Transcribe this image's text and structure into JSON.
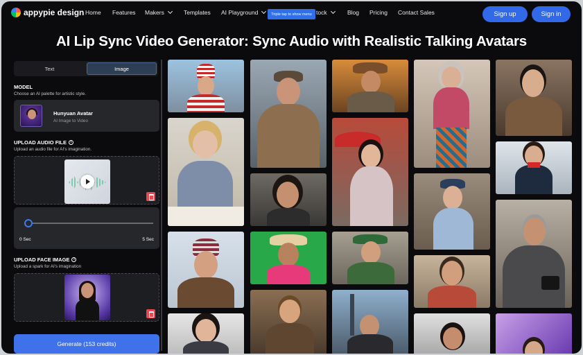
{
  "header": {
    "logo_text": "appypie design",
    "menu": [
      {
        "label": "Home",
        "dropdown": false
      },
      {
        "label": "Features",
        "dropdown": false
      },
      {
        "label": "Makers",
        "dropdown": true
      },
      {
        "label": "Templates",
        "dropdown": false
      },
      {
        "label": "AI Playground",
        "dropdown": true
      },
      {
        "label": "tock",
        "dropdown": true
      },
      {
        "label": "Blog",
        "dropdown": false
      },
      {
        "label": "Pricing",
        "dropdown": false
      },
      {
        "label": "Contact Sales",
        "dropdown": false
      }
    ],
    "tooltip": "Triple tap to show menu",
    "signup_label": "Sign up",
    "signin_label": "Sign in"
  },
  "page_title": "AI Lip Sync Video Generator: Sync Audio with Realistic Talking Avatars",
  "panel": {
    "tabs": [
      {
        "label": "Text",
        "active": false
      },
      {
        "label": "Image",
        "active": true
      }
    ],
    "model": {
      "heading": "MODEL",
      "subtitle": "Choose an AI palette for artistic style.",
      "name": "Hunyuan Avatar",
      "description": "AI Image to Video",
      "thumb_caption": "HUNYUAN AVATAR"
    },
    "audio": {
      "heading": "UPLOAD AUDIO FILE",
      "subtitle": "Upload an audio file for AI's imagination."
    },
    "duration": {
      "min_label": "0 Sec",
      "max_label": "5 Sec",
      "value_fraction": 0
    },
    "face": {
      "heading": "UPLOAD FACE IMAGE",
      "subtitle": "Upload a spark for AI's imagination"
    },
    "generate_label": "Generate (153 credits)"
  },
  "gallery": [
    {
      "subject": "man-in-flag-hat-icon"
    },
    {
      "subject": "woman-with-headphones-icon"
    },
    {
      "subject": "man-with-beanie-icon"
    },
    {
      "subject": "young-woman-icon"
    },
    {
      "subject": "man-in-flat-cap-icon"
    },
    {
      "subject": "woman-portrait-icon"
    },
    {
      "subject": "woman-in-straw-hat-icon"
    },
    {
      "subject": "man-with-beer-icon"
    },
    {
      "subject": "cowboy-icon"
    },
    {
      "subject": "woman-with-umbrella-icon"
    },
    {
      "subject": "man-in-green-hat-icon"
    },
    {
      "subject": "man-city-skyline-icon"
    },
    {
      "subject": "older-woman-icon"
    },
    {
      "subject": "woman-in-beret-icon"
    },
    {
      "subject": "smiling-man-icon"
    },
    {
      "subject": "woman-in-train-icon"
    },
    {
      "subject": "asian-man-icon"
    },
    {
      "subject": "flight-attendant-icon"
    },
    {
      "subject": "photographer-man-icon"
    },
    {
      "subject": "woman-purple-icon"
    }
  ],
  "colors": {
    "accent": "#3f72ea",
    "background": "#0b0b0d",
    "panel": "#26272b",
    "danger": "#e8474f"
  }
}
